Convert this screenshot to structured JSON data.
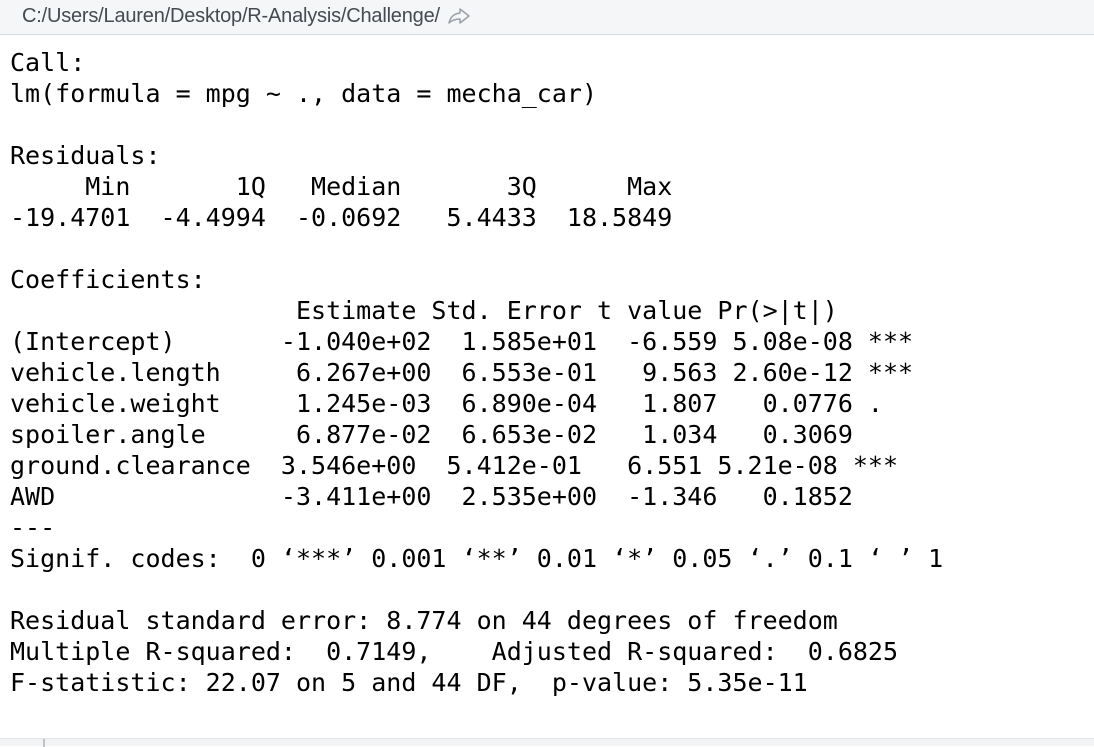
{
  "header": {
    "path": "C:/Users/Lauren/Desktop/R-Analysis/Challenge/",
    "nav_icon": "go-to-directory-icon"
  },
  "console": {
    "lines": [
      "Call:",
      "lm(formula = mpg ~ ., data = mecha_car)",
      "",
      "Residuals:",
      "     Min       1Q   Median       3Q      Max ",
      "-19.4701  -4.4994  -0.0692   5.4433  18.5849 ",
      "",
      "Coefficients:",
      "                   Estimate Std. Error t value Pr(>|t|)    ",
      "(Intercept)       -1.040e+02  1.585e+01  -6.559 5.08e-08 ***",
      "vehicle.length     6.267e+00  6.553e-01   9.563 2.60e-12 ***",
      "vehicle.weight     1.245e-03  6.890e-04   1.807   0.0776 .  ",
      "spoiler.angle      6.877e-02  6.653e-02   1.034   0.3069    ",
      "ground.clearance  3.546e+00  5.412e-01   6.551 5.21e-08 ***",
      "AWD               -3.411e+00  2.535e+00  -1.346   0.1852    ",
      "---",
      "Signif. codes:  0 ‘***’ 0.001 ‘**’ 0.01 ‘*’ 0.05 ‘.’ 0.1 ‘ ’ 1",
      "",
      "Residual standard error: 8.774 on 44 degrees of freedom",
      "Multiple R-squared:  0.7149,\tAdjusted R-squared:  0.6825 ",
      "F-statistic: 22.07 on 5 and 44 DF,  p-value: 5.35e-11"
    ]
  }
}
